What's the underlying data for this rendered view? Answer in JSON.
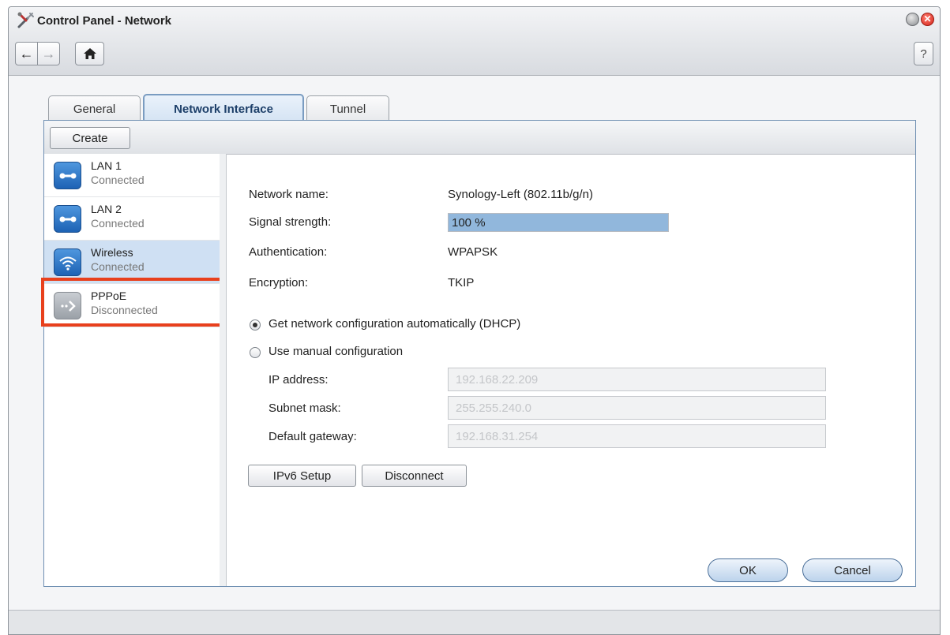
{
  "window": {
    "title": "Control Panel - Network",
    "close_glyph": "✕"
  },
  "toolbar": {
    "back_glyph": "←",
    "forward_glyph": "→",
    "home_glyph": "⌂",
    "help_label": "?"
  },
  "tabs": [
    {
      "label": "General",
      "active": false
    },
    {
      "label": "Network Interface",
      "active": true
    },
    {
      "label": "Tunnel",
      "active": false
    }
  ],
  "panel": {
    "create_label": "Create"
  },
  "interfaces": [
    {
      "name": "LAN 1",
      "status": "Connected",
      "icon": "ethernet-icon"
    },
    {
      "name": "LAN 2",
      "status": "Connected",
      "icon": "ethernet-icon"
    },
    {
      "name": "Wireless",
      "status": "Connected",
      "icon": "wifi-icon",
      "selected": true
    },
    {
      "name": "PPPoE",
      "status": "Disconnected",
      "icon": "pppoe-icon"
    }
  ],
  "details": {
    "network_name_label": "Network name:",
    "network_name_value": "Synology-Left (802.11b/g/n)",
    "signal_label": "Signal strength:",
    "signal_value": "100 %",
    "signal_percent": 100,
    "auth_label": "Authentication:",
    "auth_value": "WPAPSK",
    "enc_label": "Encryption:",
    "enc_value": "TKIP"
  },
  "config": {
    "dhcp_label": "Get network configuration automatically (DHCP)",
    "dhcp_selected": true,
    "manual_label": "Use manual configuration",
    "ip_label": "IP address:",
    "ip_value": "192.168.22.209",
    "subnet_label": "Subnet mask:",
    "subnet_value": "255.255.240.0",
    "gateway_label": "Default gateway:",
    "gateway_value": "192.168.31.254"
  },
  "actions": {
    "ipv6_label": "IPv6 Setup",
    "disconnect_label": "Disconnect",
    "ok_label": "OK",
    "cancel_label": "Cancel"
  },
  "colors": {
    "accent": "#1d62b4",
    "highlight": "#e8401d",
    "signal": "#91b7dc"
  }
}
